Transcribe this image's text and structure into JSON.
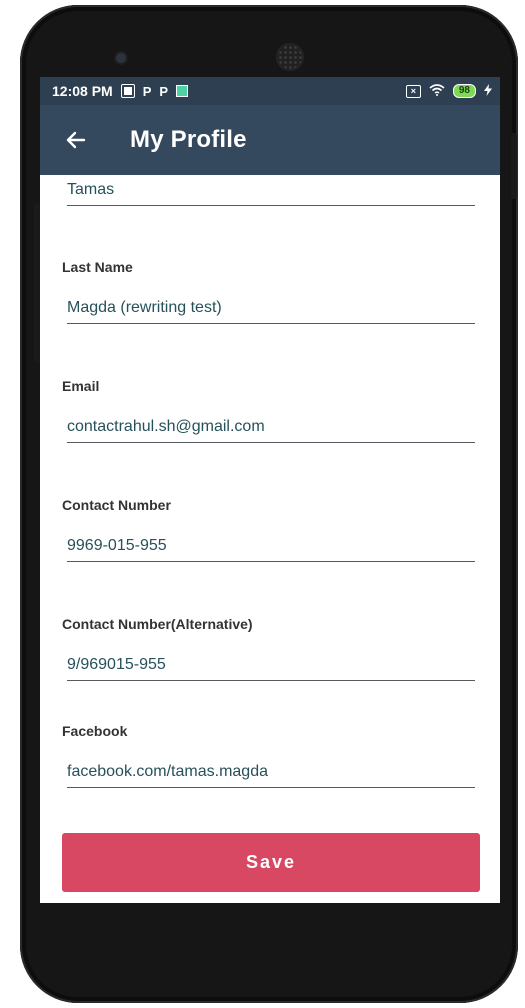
{
  "status_bar": {
    "time": "12:08 PM",
    "left_icons": [
      "photo-icon",
      "p-icon",
      "p-icon",
      "app-icon"
    ],
    "battery": "98"
  },
  "app_bar": {
    "title": "My Profile",
    "back_icon": "arrow-left-icon"
  },
  "form": {
    "first_name_value": "Tamas",
    "last_name_label": "Last Name",
    "last_name_value": "Magda (rewriting test)",
    "email_label": "Email",
    "email_value": "contactrahul.sh@gmail.com",
    "contact_label": "Contact Number",
    "contact_value": "9969-015-955",
    "contact_alt_label": "Contact Number(Alternative)",
    "contact_alt_value": "9/969015-955",
    "facebook_label": "Facebook",
    "facebook_value": "facebook.com/tamas.magda",
    "save_label": "Save"
  },
  "colors": {
    "status_bar": "#2e3f52",
    "app_bar": "#34495e",
    "save_button": "#d84862"
  }
}
